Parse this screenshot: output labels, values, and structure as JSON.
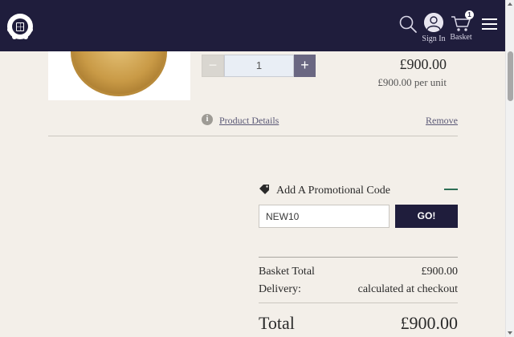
{
  "header": {
    "sign_in_label": "Sign In",
    "basket_label": "Basket",
    "basket_count": "1"
  },
  "product": {
    "quantity": "1",
    "minus_glyph": "−",
    "plus_glyph": "+",
    "price": "£900.00",
    "unit_price": "£900.00 per unit",
    "details_link": "Product Details",
    "remove_link": "Remove",
    "info_glyph": "i"
  },
  "promo": {
    "title": "Add A Promotional Code",
    "input_value": "NEW10",
    "go_label": "GO!"
  },
  "summary": {
    "basket_total_label": "Basket Total",
    "basket_total_value": "£900.00",
    "delivery_label": "Delivery:",
    "delivery_value": "calculated at checkout",
    "total_label": "Total",
    "total_value": "£900.00"
  },
  "colors": {
    "header_bg": "#1f1d3c",
    "page_bg": "#f3efe9",
    "accent_green": "#2d6e55",
    "plus_button": "#6a6782"
  },
  "icons": [
    "royal-crest-logo",
    "search-icon",
    "user-icon",
    "basket-icon",
    "hamburger-menu-icon",
    "info-icon",
    "tag-icon",
    "collapse-minus-icon"
  ]
}
